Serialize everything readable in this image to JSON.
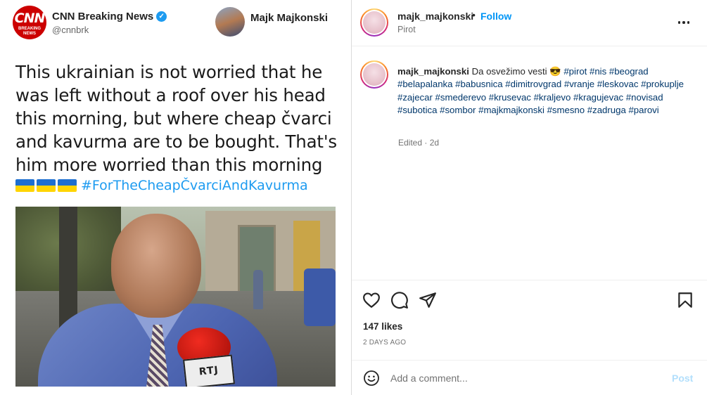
{
  "tweet": {
    "author_name": "CNN Breaking News",
    "author_handle": "@cnnbrk",
    "logo_text": "CNN",
    "logo_subtext": "BREAKING NEWS",
    "second_user_name": "Majk Majkonski",
    "text": "This ukrainian is not worried that he was left without a roof over his head this morning, but where cheap čvarci and kavurma are to be bought. That's him more worried than this morning",
    "flag_emoji_count": 3,
    "hashtag": "#ForTheCheapČvarciAndKavurma",
    "photo_mic_label": "RTJ"
  },
  "header": {
    "username": "majk_majkonski",
    "separator": "•",
    "follow_label": "Follow",
    "location": "Pirot"
  },
  "caption": {
    "username": "majk_majkonski",
    "text": "Da osvežimo vesti 😎",
    "hashtags": [
      "#pirot",
      "#nis",
      "#beograd",
      "#belapalanka",
      "#babusnica",
      "#dimitrovgrad",
      "#vranje",
      "#leskovac",
      "#prokuplje",
      "#zajecar",
      "#smederevo",
      "#krusevac",
      "#kraljevo",
      "#kragujevac",
      "#novisad",
      "#subotica",
      "#sombor",
      "#majkmajkonski",
      "#smesno",
      "#zadruga",
      "#parovi"
    ],
    "meta": "Edited · 2d"
  },
  "actions": {
    "likes": "147 likes",
    "date": "2 DAYS AGO"
  },
  "comment": {
    "placeholder": "Add a comment...",
    "post_label": "Post"
  },
  "icons": {
    "like": "heart-icon",
    "comment": "comment-icon",
    "share": "share-icon",
    "save": "bookmark-icon",
    "emoji": "emoji-icon",
    "more": "more-options-icon",
    "verified": "verified-badge-icon"
  },
  "colors": {
    "link": "#0095f6",
    "hashtag": "#00376b",
    "twitter_blue": "#1d9bf0",
    "cnn_red": "#cc0000"
  }
}
